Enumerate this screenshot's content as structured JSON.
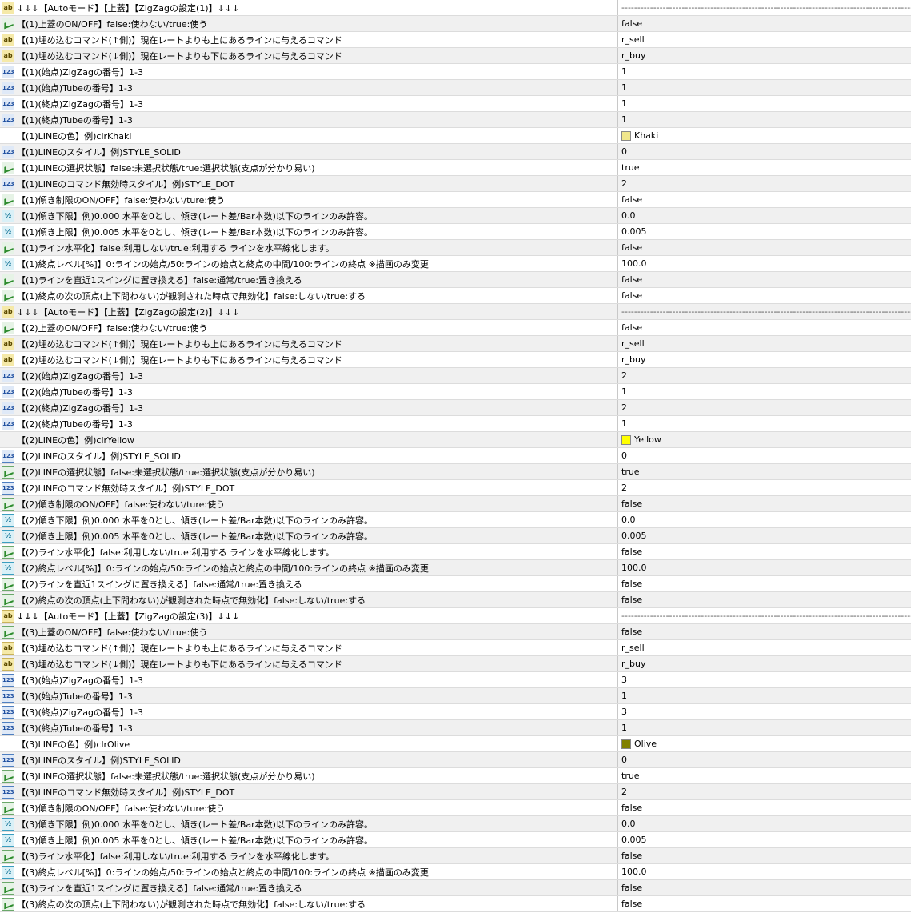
{
  "rows": [
    {
      "icon": "ab",
      "name": "↓↓↓【Autoモード】【上蓋】【ZigZagの設定(1)】↓↓↓",
      "value": "--------------------------------------------------------------------------------------------------------------------------------------------",
      "sep": true
    },
    {
      "icon": "bool",
      "name": "【(1)上蓋のON/OFF】false:使わない/true:使う",
      "value": "false"
    },
    {
      "icon": "ab",
      "name": "【(1)埋め込むコマンド(↑側)】現在レートよりも上にあるラインに与えるコマンド",
      "value": "r_sell"
    },
    {
      "icon": "ab",
      "name": "【(1)埋め込むコマンド(↓側)】現在レートよりも下にあるラインに与えるコマンド",
      "value": "r_buy"
    },
    {
      "icon": "int",
      "name": "【(1)(始点)ZigZagの番号】1-3",
      "value": "1"
    },
    {
      "icon": "int",
      "name": "【(1)(始点)Tubeの番号】1-3",
      "value": "1"
    },
    {
      "icon": "int",
      "name": "【(1)(終点)ZigZagの番号】1-3",
      "value": "1"
    },
    {
      "icon": "int",
      "name": "【(1)(終点)Tubeの番号】1-3",
      "value": "1"
    },
    {
      "icon": "color",
      "name": "【(1)LINEの色】例)clrKhaki",
      "value": "Khaki",
      "swatch": "#f0e68c"
    },
    {
      "icon": "int",
      "name": "【(1)LINEのスタイル】例)STYLE_SOLID",
      "value": "0"
    },
    {
      "icon": "bool",
      "name": "【(1)LINEの選択状態】false:未選択状態/true:選択状態(支点が分かり易い)",
      "value": "true"
    },
    {
      "icon": "int",
      "name": "【(1)LINEのコマンド無効時スタイル】例)STYLE_DOT",
      "value": "2"
    },
    {
      "icon": "bool",
      "name": "【(1)傾き制限のON/OFF】false:使わない/ture:使う",
      "value": "false"
    },
    {
      "icon": "dbl",
      "name": "【(1)傾き下限】例)0.000 水平を0とし、傾き(レート差/Bar本数)以下のラインのみ許容。",
      "value": "0.0"
    },
    {
      "icon": "dbl",
      "name": "【(1)傾き上限】例)0.005 水平を0とし、傾き(レート差/Bar本数)以下のラインのみ許容。",
      "value": "0.005"
    },
    {
      "icon": "bool",
      "name": "【(1)ライン水平化】false:利用しない/true:利用する ラインを水平線化します。",
      "value": "false"
    },
    {
      "icon": "dbl",
      "name": "【(1)終点レベル[%]】0:ラインの始点/50:ラインの始点と終点の中間/100:ラインの終点 ※描画のみ変更",
      "value": "100.0"
    },
    {
      "icon": "bool",
      "name": "【(1)ラインを直近1スイングに置き換える】false:通常/true:置き換える",
      "value": "false"
    },
    {
      "icon": "bool",
      "name": "【(1)終点の次の頂点(上下問わない)が観測された時点で無効化】false:しない/true:する",
      "value": "false"
    },
    {
      "icon": "ab",
      "name": "↓↓↓【Autoモード】【上蓋】【ZigZagの設定(2)】↓↓↓",
      "value": "--------------------------------------------------------------------------------------------------------------------------------------------",
      "sep": true
    },
    {
      "icon": "bool",
      "name": "【(2)上蓋のON/OFF】false:使わない/true:使う",
      "value": "false"
    },
    {
      "icon": "ab",
      "name": "【(2)埋め込むコマンド(↑側)】現在レートよりも上にあるラインに与えるコマンド",
      "value": "r_sell"
    },
    {
      "icon": "ab",
      "name": "【(2)埋め込むコマンド(↓側)】現在レートよりも下にあるラインに与えるコマンド",
      "value": "r_buy"
    },
    {
      "icon": "int",
      "name": "【(2)(始点)ZigZagの番号】1-3",
      "value": "2"
    },
    {
      "icon": "int",
      "name": "【(2)(始点)Tubeの番号】1-3",
      "value": "1"
    },
    {
      "icon": "int",
      "name": "【(2)(終点)ZigZagの番号】1-3",
      "value": "2"
    },
    {
      "icon": "int",
      "name": "【(2)(終点)Tubeの番号】1-3",
      "value": "1"
    },
    {
      "icon": "color",
      "name": "【(2)LINEの色】例)clrYellow",
      "value": "Yellow",
      "swatch": "#ffff00"
    },
    {
      "icon": "int",
      "name": "【(2)LINEのスタイル】例)STYLE_SOLID",
      "value": "0"
    },
    {
      "icon": "bool",
      "name": "【(2)LINEの選択状態】false:未選択状態/true:選択状態(支点が分かり易い)",
      "value": "true"
    },
    {
      "icon": "int",
      "name": "【(2)LINEのコマンド無効時スタイル】例)STYLE_DOT",
      "value": "2"
    },
    {
      "icon": "bool",
      "name": "【(2)傾き制限のON/OFF】false:使わない/ture:使う",
      "value": "false"
    },
    {
      "icon": "dbl",
      "name": "【(2)傾き下限】例)0.000 水平を0とし、傾き(レート差/Bar本数)以下のラインのみ許容。",
      "value": "0.0"
    },
    {
      "icon": "dbl",
      "name": "【(2)傾き上限】例)0.005 水平を0とし、傾き(レート差/Bar本数)以下のラインのみ許容。",
      "value": "0.005"
    },
    {
      "icon": "bool",
      "name": "【(2)ライン水平化】false:利用しない/true:利用する ラインを水平線化します。",
      "value": "false"
    },
    {
      "icon": "dbl",
      "name": "【(2)終点レベル[%]】0:ラインの始点/50:ラインの始点と終点の中間/100:ラインの終点 ※描画のみ変更",
      "value": "100.0"
    },
    {
      "icon": "bool",
      "name": "【(2)ラインを直近1スイングに置き換える】false:通常/true:置き換える",
      "value": "false"
    },
    {
      "icon": "bool",
      "name": "【(2)終点の次の頂点(上下問わない)が観測された時点で無効化】false:しない/true:する",
      "value": "false"
    },
    {
      "icon": "ab",
      "name": "↓↓↓【Autoモード】【上蓋】【ZigZagの設定(3)】↓↓↓",
      "value": "--------------------------------------------------------------------------------------------------------------------------------------------",
      "sep": true
    },
    {
      "icon": "bool",
      "name": "【(3)上蓋のON/OFF】false:使わない/true:使う",
      "value": "false"
    },
    {
      "icon": "ab",
      "name": "【(3)埋め込むコマンド(↑側)】現在レートよりも上にあるラインに与えるコマンド",
      "value": "r_sell"
    },
    {
      "icon": "ab",
      "name": "【(3)埋め込むコマンド(↓側)】現在レートよりも下にあるラインに与えるコマンド",
      "value": "r_buy"
    },
    {
      "icon": "int",
      "name": "【(3)(始点)ZigZagの番号】1-3",
      "value": "3"
    },
    {
      "icon": "int",
      "name": "【(3)(始点)Tubeの番号】1-3",
      "value": "1"
    },
    {
      "icon": "int",
      "name": "【(3)(終点)ZigZagの番号】1-3",
      "value": "3"
    },
    {
      "icon": "int",
      "name": "【(3)(終点)Tubeの番号】1-3",
      "value": "1"
    },
    {
      "icon": "color",
      "name": "【(3)LINEの色】例)clrOlive",
      "value": "Olive",
      "swatch": "#808000"
    },
    {
      "icon": "int",
      "name": "【(3)LINEのスタイル】例)STYLE_SOLID",
      "value": "0"
    },
    {
      "icon": "bool",
      "name": "【(3)LINEの選択状態】false:未選択状態/true:選択状態(支点が分かり易い)",
      "value": "true"
    },
    {
      "icon": "int",
      "name": "【(3)LINEのコマンド無効時スタイル】例)STYLE_DOT",
      "value": "2"
    },
    {
      "icon": "bool",
      "name": "【(3)傾き制限のON/OFF】false:使わない/ture:使う",
      "value": "false"
    },
    {
      "icon": "dbl",
      "name": "【(3)傾き下限】例)0.000 水平を0とし、傾き(レート差/Bar本数)以下のラインのみ許容。",
      "value": "0.0"
    },
    {
      "icon": "dbl",
      "name": "【(3)傾き上限】例)0.005 水平を0とし、傾き(レート差/Bar本数)以下のラインのみ許容。",
      "value": "0.005"
    },
    {
      "icon": "bool",
      "name": "【(3)ライン水平化】false:利用しない/true:利用する ラインを水平線化します。",
      "value": "false"
    },
    {
      "icon": "dbl",
      "name": "【(3)終点レベル[%]】0:ラインの始点/50:ラインの始点と終点の中間/100:ラインの終点 ※描画のみ変更",
      "value": "100.0"
    },
    {
      "icon": "bool",
      "name": "【(3)ラインを直近1スイングに置き換える】false:通常/true:置き換える",
      "value": "false"
    },
    {
      "icon": "bool",
      "name": "【(3)終点の次の頂点(上下問わない)が観測された時点で無効化】false:しない/true:する",
      "value": "false"
    }
  ]
}
